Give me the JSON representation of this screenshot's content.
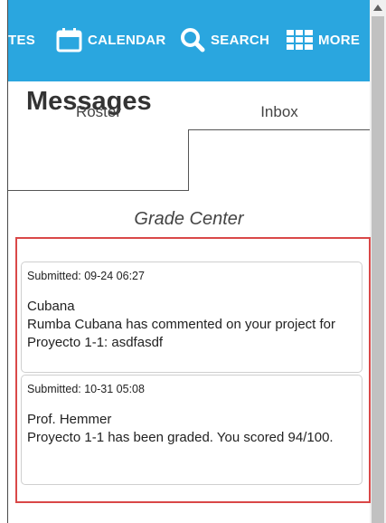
{
  "nav": {
    "partial_label": "TES",
    "calendar_label": "CALENDAR",
    "search_label": "SEARCH",
    "more_label": "MORE",
    "bar_color": "#2aa6df",
    "calendar_icon": "calendar-icon",
    "search_icon": "search-icon",
    "more_icon": "grid-icon"
  },
  "page": {
    "title": "Messages",
    "tabs": [
      {
        "label": "Roster",
        "active": false
      },
      {
        "label": "Inbox",
        "active": true
      }
    ],
    "section_title": "Grade Center",
    "highlight_color": "#d94848"
  },
  "messages": [
    {
      "submitted": "Submitted: 09-24 06:27",
      "sender": "Cubana",
      "body": "Rumba Cubana has commented on your project for Proyecto 1-1: asdfasdf"
    },
    {
      "submitted": "Submitted: 10-31 05:08",
      "sender": "Prof. Hemmer",
      "body": "Proyecto 1-1 has been graded. You scored 94/100."
    }
  ]
}
